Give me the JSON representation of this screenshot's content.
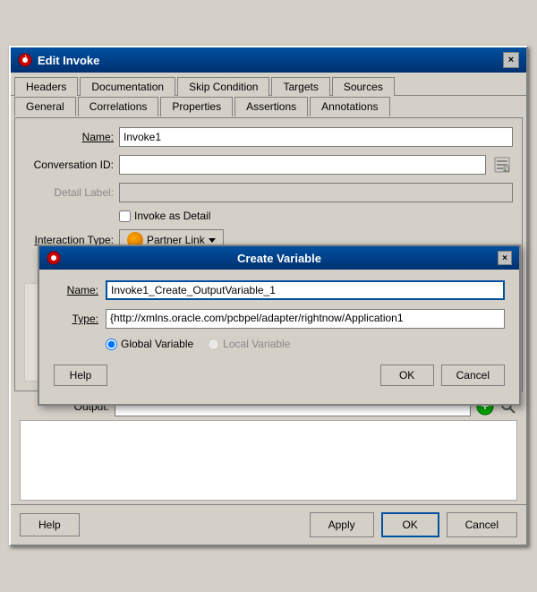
{
  "mainDialog": {
    "title": "Edit Invoke",
    "closeLabel": "×",
    "tabs1": [
      {
        "label": "Headers",
        "active": false
      },
      {
        "label": "Documentation",
        "active": false
      },
      {
        "label": "Skip Condition",
        "active": false
      },
      {
        "label": "Targets",
        "active": false
      },
      {
        "label": "Sources",
        "active": false
      }
    ],
    "tabs2": [
      {
        "label": "General",
        "active": true
      },
      {
        "label": "Correlations",
        "active": false
      },
      {
        "label": "Properties",
        "active": false
      },
      {
        "label": "Assertions",
        "active": false
      },
      {
        "label": "Annotations",
        "active": false
      }
    ],
    "form": {
      "nameLabel": "Name:",
      "nameValue": "Invoke1",
      "conversationIdLabel": "Conversation ID:",
      "conversationIdValue": "",
      "detailLabelLabel": "Detail Label:",
      "detailLabelValue": "",
      "invokeAsDetailLabel": "Invoke as Detail",
      "interactionTypeLabel": "Interaction Type:",
      "interactionTypeValue": "Partner Link",
      "outputLabel": "Output:"
    }
  },
  "createVariableDialog": {
    "title": "Create Variable",
    "closeLabel": "×",
    "nameLabel": "Name:",
    "nameValue": "Invoke1_Create_OutputVariable_1",
    "typeLabel": "Type:",
    "typeValue": "{http://xmlns.oracle.com/pcbpel/adapter/rightnow/Application1",
    "radioGlobal": "Global Variable",
    "radioLocal": "Local Variable",
    "helpLabel": "Help",
    "okLabel": "OK",
    "cancelLabel": "Cancel"
  },
  "bottomButtons": {
    "helpLabel": "Help",
    "applyLabel": "Apply",
    "okLabel": "OK",
    "cancelLabel": "Cancel"
  },
  "icons": {
    "oracle": "◉",
    "close": "×",
    "spreadsheet": "📋",
    "greenPlus": "+",
    "search": "🔍",
    "partnerLink": "⊙"
  }
}
